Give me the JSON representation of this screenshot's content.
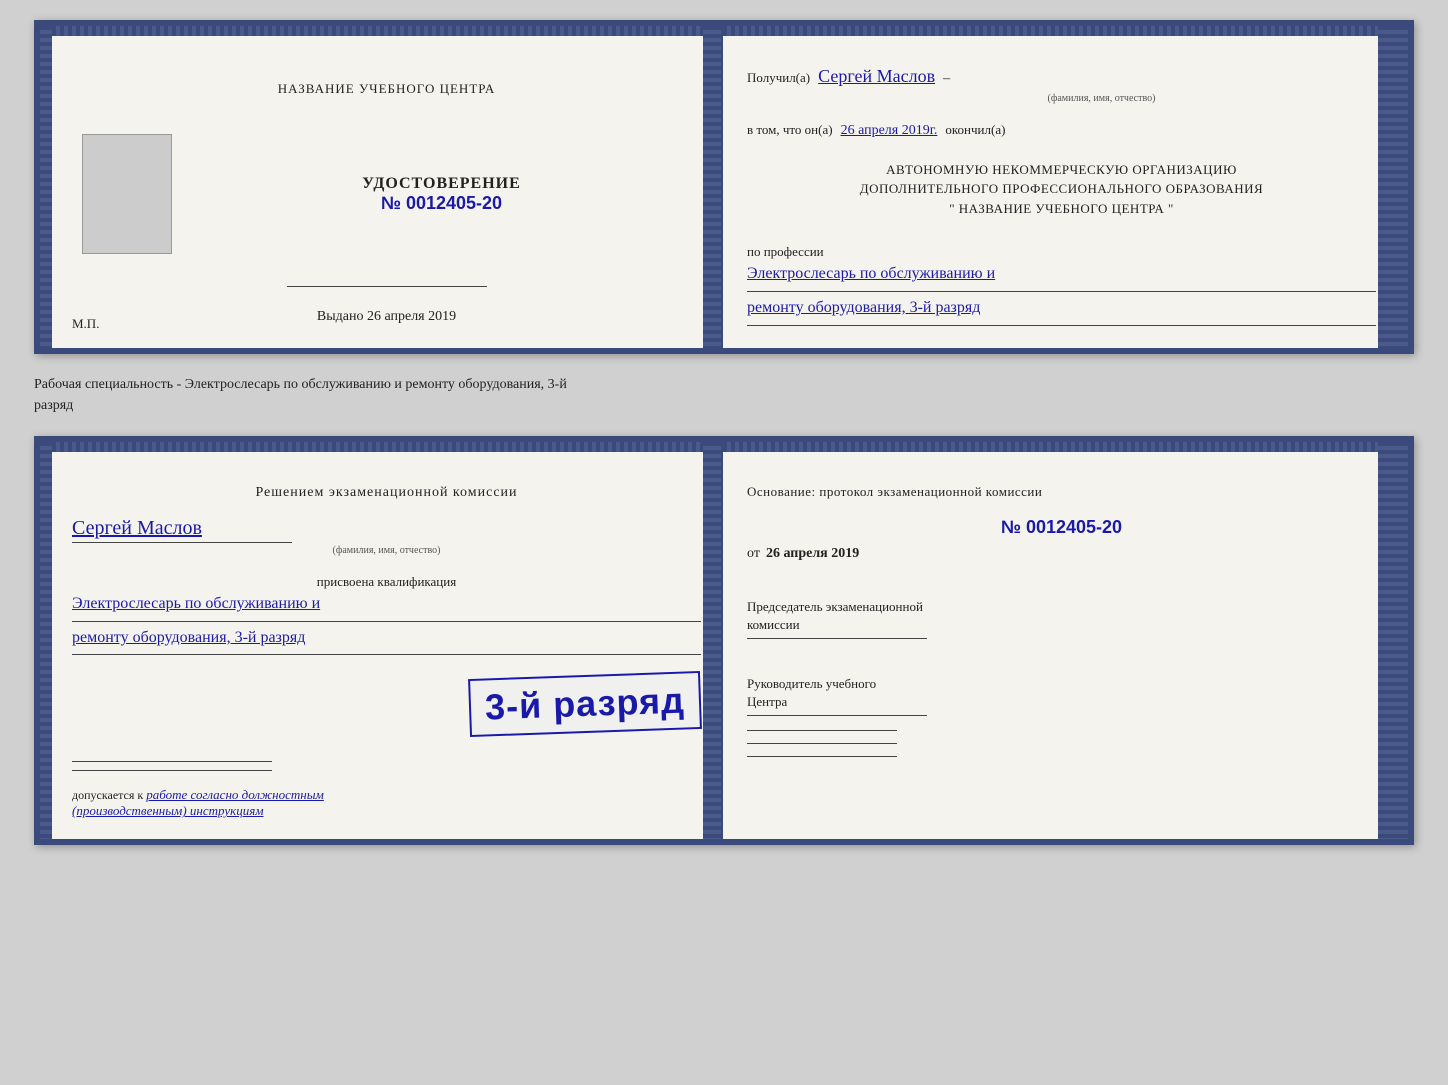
{
  "book1": {
    "left": {
      "center_title": "НАЗВАНИЕ УЧЕБНОГО ЦЕНТРА",
      "cert_label": "УДОСТОВЕРЕНИЕ",
      "cert_number": "№ 0012405-20",
      "issued_label": "Выдано",
      "issued_date": "26 апреля 2019",
      "mp": "М.П."
    },
    "right": {
      "received_label": "Получил(а)",
      "recipient_name": "Сергей Маслов",
      "name_subtitle": "(фамилия, имя, отчество)",
      "in_that_label": "в том, что он(а)",
      "date_value": "26 апреля 2019г.",
      "finished_label": "окончил(а)",
      "org_line1": "АВТОНОМНУЮ НЕКОММЕРЧЕСКУЮ ОРГАНИЗАЦИЮ",
      "org_line2": "ДОПОЛНИТЕЛЬНОГО ПРОФЕССИОНАЛЬНОГО ОБРАЗОВАНИЯ",
      "org_line3": "\"  НАЗВАНИЕ УЧЕБНОГО ЦЕНТРА  \"",
      "profession_label": "по профессии",
      "profession_line1": "Электрослесарь по обслуживанию и",
      "profession_line2": "ремонту оборудования, 3-й разряд"
    }
  },
  "between_label": "Рабочая специальность - Электрослесарь по обслуживанию и ремонту оборудования, 3-й\nразряд",
  "book2": {
    "left": {
      "decision_title": "Решением экзаменационной комиссии",
      "person_name": "Сергей Маслов",
      "name_subtitle": "(фамилия, имя, отчество)",
      "assigned_label": "присвоена квалификация",
      "qualification_line1": "Электрослесарь по обслуживанию и",
      "qualification_line2": "ремонту оборудования, 3-й разряд",
      "stamp_text": "3-й разряд",
      "allowed_label": "допускается к",
      "allowed_text": "работе согласно должностным\n(производственным) инструкциям"
    },
    "right": {
      "basis_label": "Основание: протокол экзаменационной комиссии",
      "basis_number": "№  0012405-20",
      "basis_date_prefix": "от",
      "basis_date": "26 апреля 2019",
      "chairman_label": "Председатель экзаменационной\nкомиссии",
      "leader_label": "Руководитель учебного\nЦентра"
    }
  }
}
